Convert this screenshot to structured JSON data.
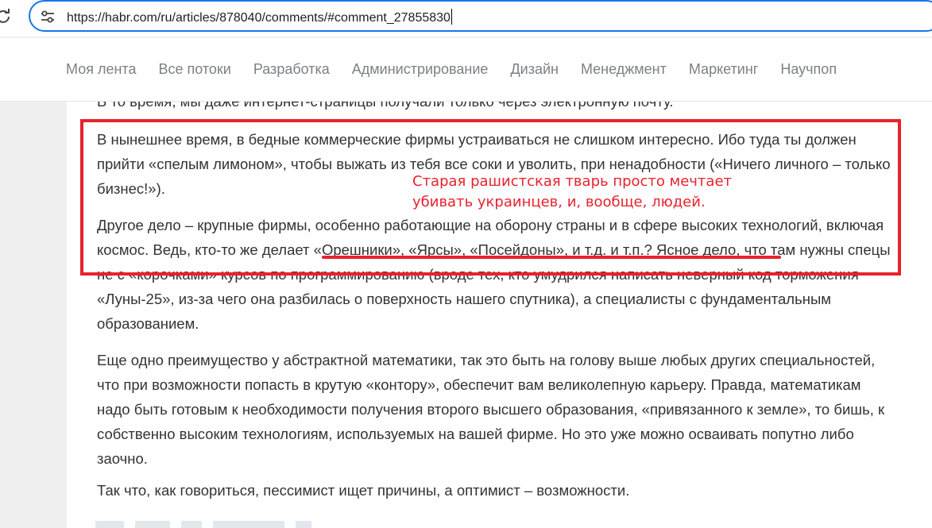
{
  "browser": {
    "url": "https://habr.com/ru/articles/878040/comments/#comment_27855830"
  },
  "nav": {
    "items": [
      "Моя лента",
      "Все потоки",
      "Разработка",
      "Администрирование",
      "Дизайн",
      "Менеджмент",
      "Маркетинг",
      "Научпоп"
    ]
  },
  "article": {
    "cut_line": "В то время, мы даже интернет-страницы получали только через электронную почту.",
    "paragraphs": [
      "В нынешнее время, в бедные коммерческие фирмы устраиваться не слишком интересно. Ибо туда ты должен прийти «спелым лимоном», чтобы выжать из тебя все соки и уволить, при ненадобности («Ничего личного – только бизнес!»).",
      "Другое дело – крупные фирмы, особенно работающие на оборону страны и в сфере высоких технологий, включая космос. Ведь, кто-то же делает «Орешники», «Ярсы», «Посейдоны», и т.д. и т.п.? Ясное дело, что там нужны спецы не с «корочками» курсов по программированию (вроде тех, кто умудрился написать неверный код торможения «Луны-25», из-за чего она разбилась о поверхность нашего спутника), а специалисты с фундаментальным образованием.",
      "Еще одно преимущество у абстрактной математики, так это быть на голову выше любых других специальностей, что при возможности попасть в крутую «контору», обеспечит вам великолепную карьеру. Правда, математикам надо быть готовым к необходимости получения второго высшего образования, «привязанного к земле», то бишь, к собственно высоким технологиям, используемых на вашей фирме. Но это уже можно осваивать попутно либо заочно.",
      "Так что, как говориться, пессимист ищет причины, а оптимист – возможности."
    ]
  },
  "annotation": {
    "line1": "Старая рашистская тварь просто мечтает",
    "line2": "убивать украинцев, и, вообще, людей."
  },
  "colors": {
    "accent_red": "#e8222e",
    "address_border": "#1a73e8",
    "nav_text": "#7b8185",
    "body_text": "#333333"
  }
}
